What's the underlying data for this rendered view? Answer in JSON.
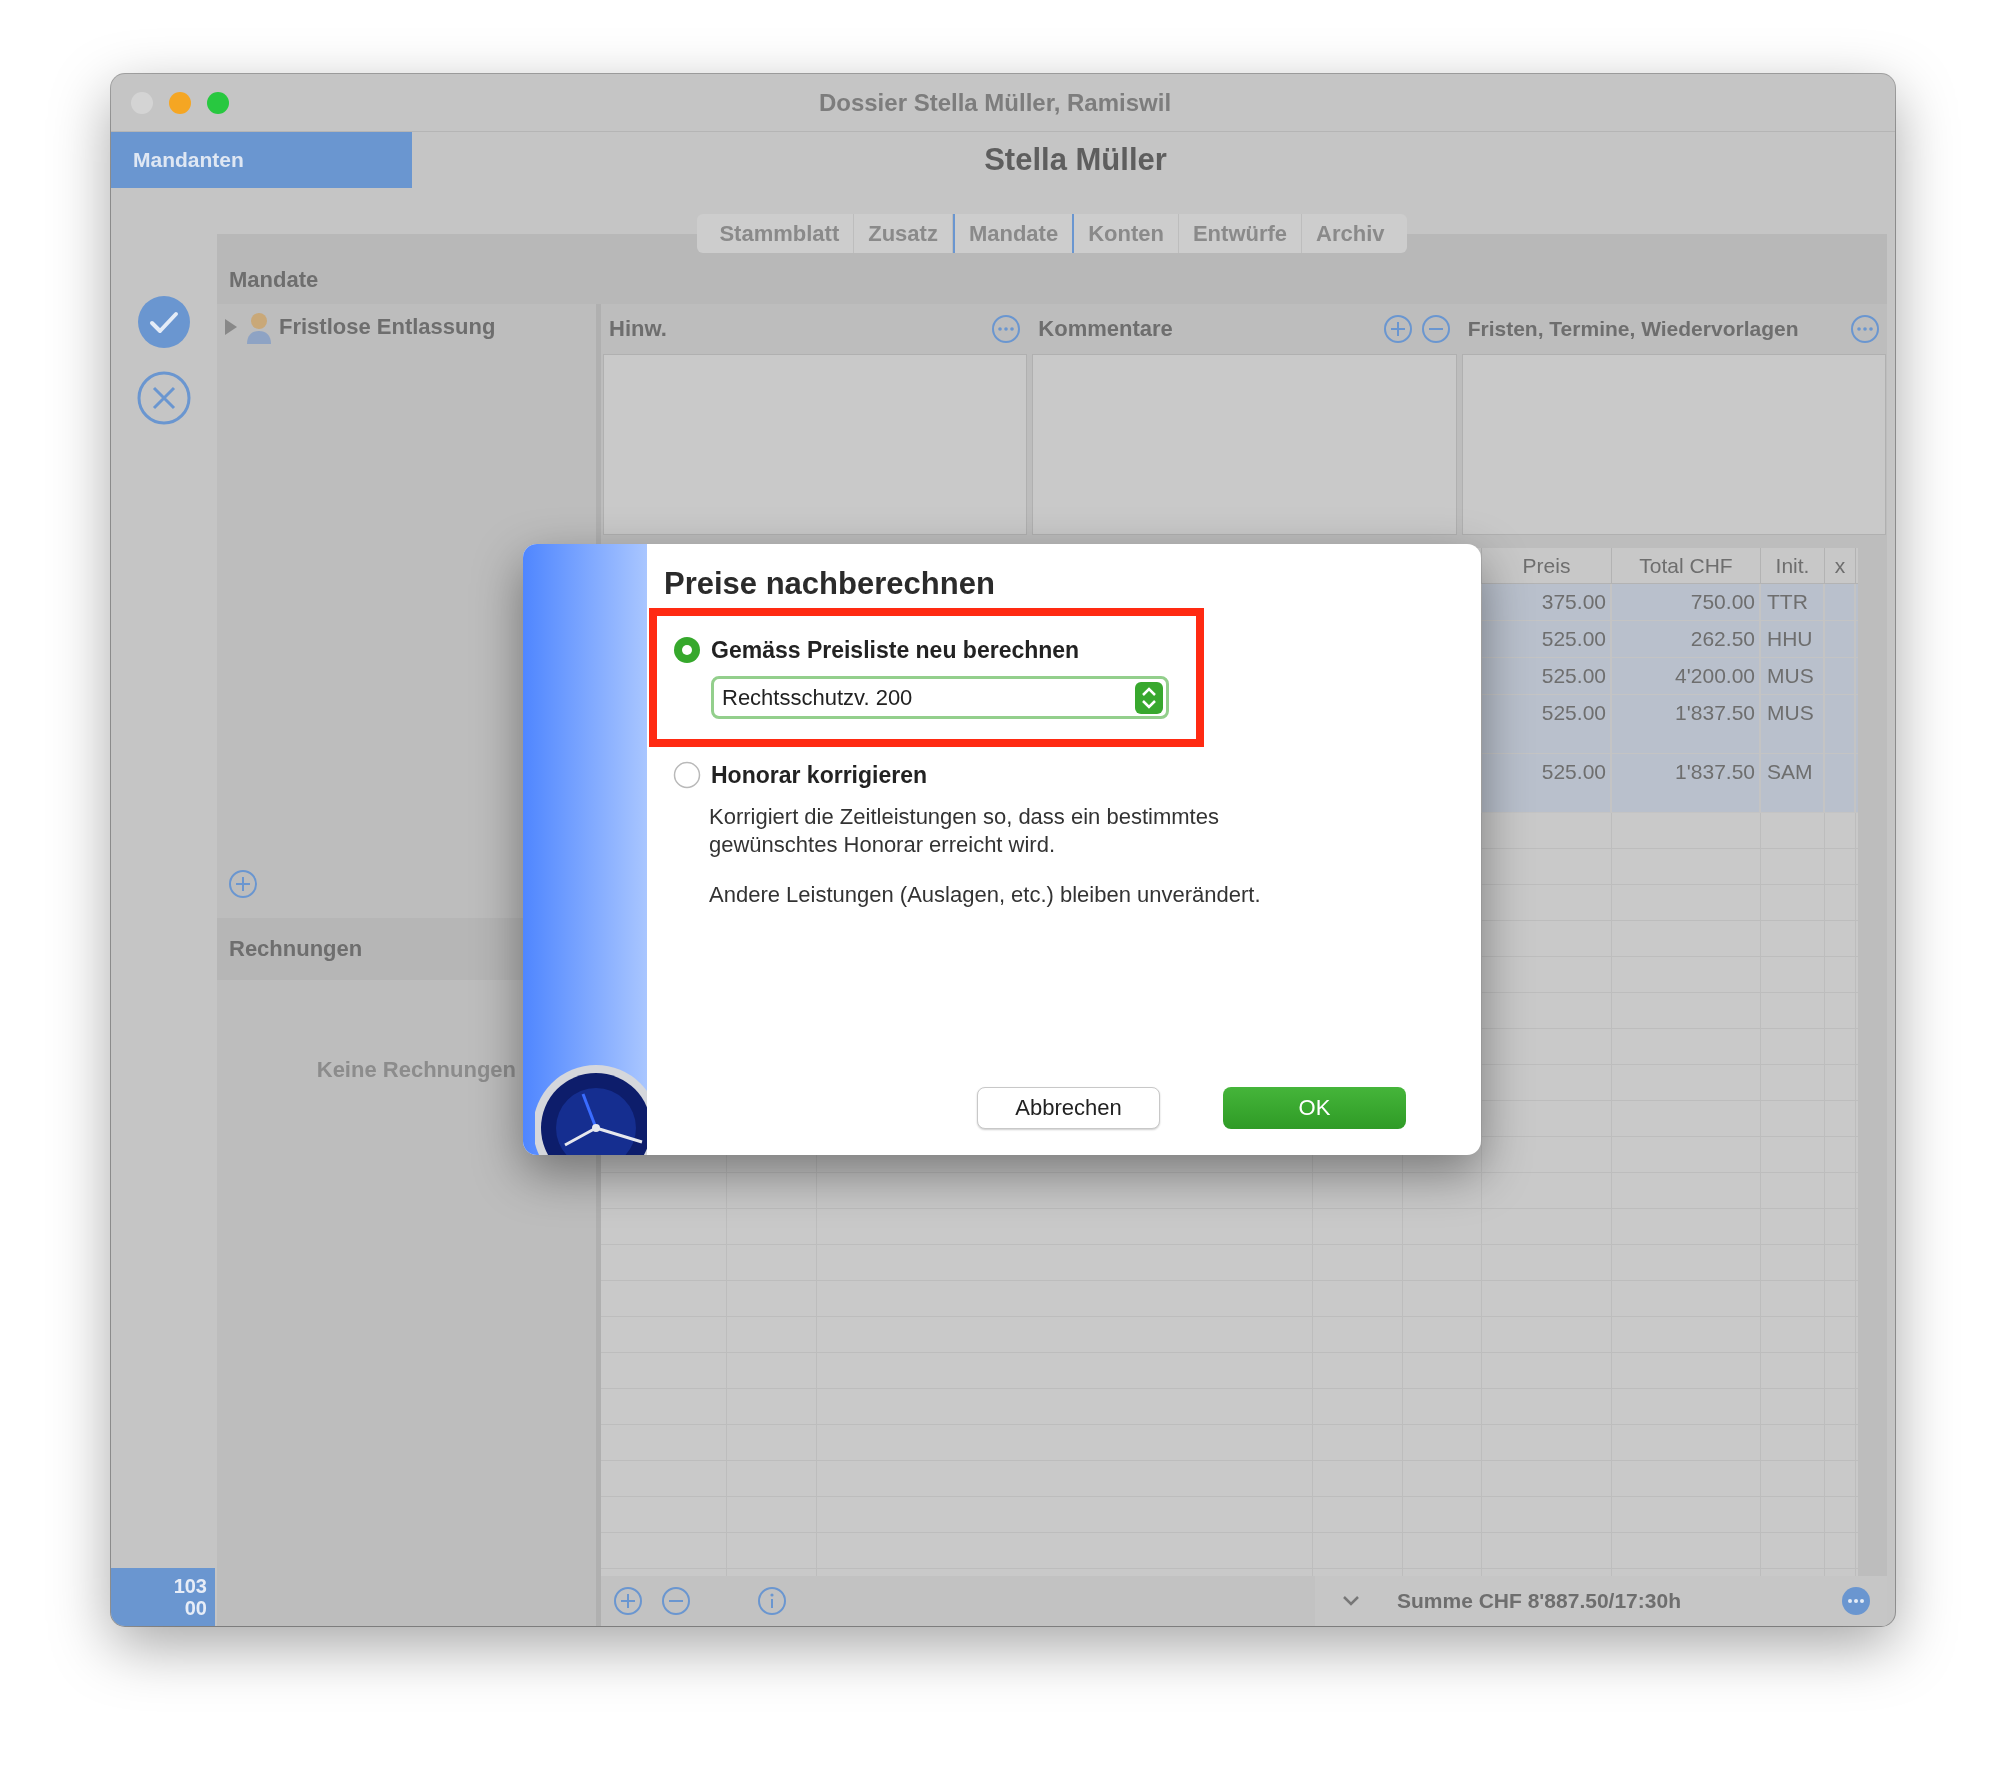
{
  "window": {
    "title": "Dossier Stella Müller, Ramiswil"
  },
  "sidebar_tab": {
    "label": "Mandanten"
  },
  "header": {
    "title": "Stella Müller"
  },
  "tabs": [
    {
      "label": "Stammblatt",
      "selected": false
    },
    {
      "label": "Zusatz",
      "selected": false
    },
    {
      "label": "Mandate",
      "selected": true
    },
    {
      "label": "Konten",
      "selected": false
    },
    {
      "label": "Entwürfe",
      "selected": false
    },
    {
      "label": "Archiv",
      "selected": false
    }
  ],
  "mandate_panel": {
    "title": "Mandate",
    "items": [
      {
        "label": "Fristlose Entlassung",
        "expanded": false
      }
    ]
  },
  "sections": [
    {
      "title": "Hinw.",
      "kind": "more"
    },
    {
      "title": "Kommentare",
      "kind": "add_remove"
    },
    {
      "title": "Fristen, Termine, Wiedervorlagen",
      "kind": "more"
    }
  ],
  "table": {
    "columns": [
      "Preis",
      "Total CHF",
      "Init.",
      "x"
    ],
    "rows": [
      {
        "cells": [
          "375.00",
          "750.00",
          "TTR"
        ],
        "selected": true,
        "kind": "normal"
      },
      {
        "cells": [
          "525.00",
          "262.50",
          "HHU"
        ],
        "selected": true,
        "kind": "normal"
      },
      {
        "cells": [
          "525.00",
          "4'200.00",
          "MUS"
        ],
        "selected": true,
        "kind": "normal"
      },
      {
        "cells": [
          "525.00",
          "1'837.50",
          "MUS"
        ],
        "selected": true,
        "kind": "tall"
      },
      {
        "cells": [
          "525.00",
          "1'837.50",
          "SAM"
        ],
        "selected": true,
        "kind": "tall"
      }
    ]
  },
  "invoices": {
    "title": "Rechnungen",
    "empty_text": "Keine Rechnungen"
  },
  "footer": {
    "counter": [
      "103",
      "00"
    ],
    "summary": "Summe CHF 8'887.50/17:30h"
  },
  "dialog": {
    "title": "Preise nachberechnen",
    "options": [
      {
        "label": "Gemäss Preisliste neu berechnen",
        "selected": true,
        "highlighted": true,
        "popup": {
          "value": "Rechtsschutzv. 200"
        }
      },
      {
        "label": "Honorar korrigieren",
        "selected": false,
        "highlighted": false,
        "paragraphs": [
          "Korrigiert die Zeitleistungen so, dass ein bestimmtes gewünschtes Honorar erreicht wird.",
          "Andere Leistungen (Auslagen, etc.) bleiben unverändert."
        ]
      }
    ],
    "buttons": [
      {
        "label": "Abbrechen",
        "kind": "secondary"
      },
      {
        "label": "OK",
        "kind": "primary"
      }
    ]
  }
}
